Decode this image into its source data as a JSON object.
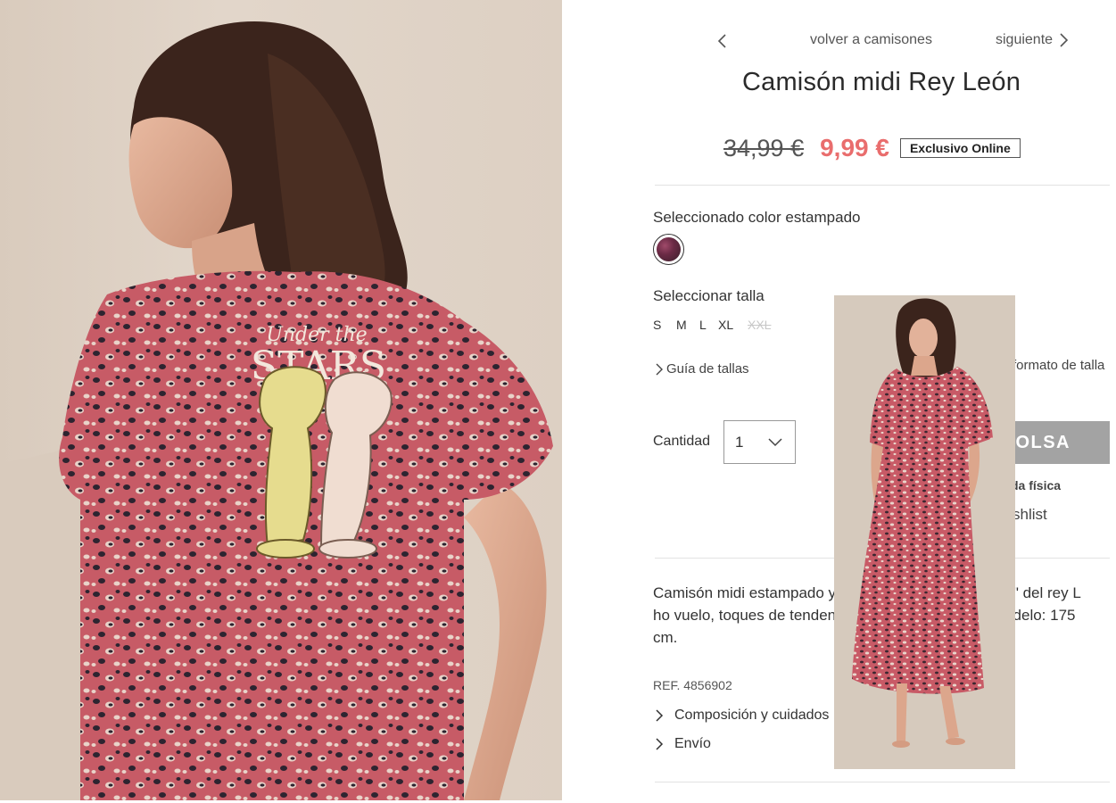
{
  "nav": {
    "back_label": "volver a camisones",
    "next_label": "siguiente"
  },
  "product": {
    "title": "Camisón midi Rey León",
    "old_price": "34,99 €",
    "price": "9,99 €",
    "badge": "Exclusivo Online",
    "color_label": "Seleccionado color estampado",
    "size_label": "Seleccionar talla",
    "sizes": [
      "S",
      "M",
      "L",
      "XL",
      "XXL"
    ],
    "sizes_available": [
      true,
      true,
      true,
      true,
      false
    ],
    "size_guide_label": "Guía de tallas",
    "size_format_label": "formato de talla",
    "quantity_label": "Cantidad",
    "quantity_value": "1",
    "add_bag_label": "BOLSA",
    "store_label": "da física",
    "wishlist_label": "shlist",
    "description": "Camisón midi estampado                               y mensaje \"Under the Stars\" del rey L                              ho vuelo, toques de tendencia y det                              el cine. Altura modelo: 175 cm.",
    "ref": "REF. 4856902",
    "accordion": [
      "Composición y cuidados",
      "Envío"
    ]
  },
  "hero_print": {
    "line1": "Under the",
    "line2": "STARS"
  },
  "colors": {
    "sale_price": "#e96d6d",
    "button_gray": "#a3a3a3",
    "dress_rose": "#c85a66"
  }
}
